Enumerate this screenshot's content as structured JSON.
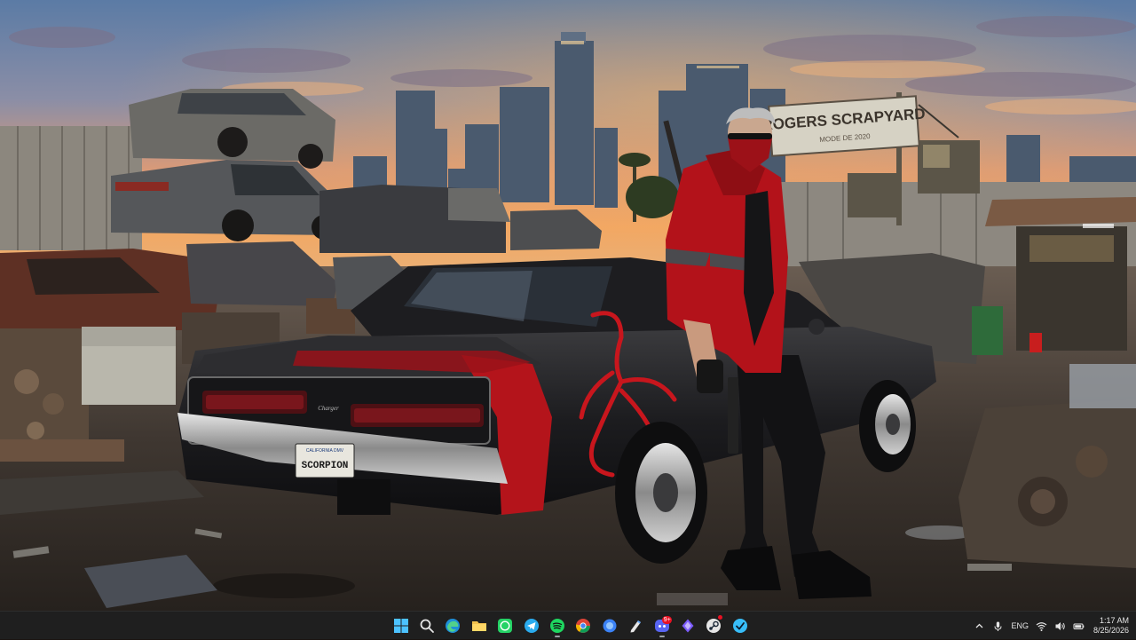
{
  "wallpaper": {
    "sign_text": "ROGERS SCRAPYARD",
    "sign_subtext": "MODE DE 2020",
    "plate_state": "CALIFORNIA DMV",
    "plate_text": "SCORPION",
    "car_badge": "Charger"
  },
  "taskbar": {
    "apps": [
      {
        "name": "start",
        "icon": "windows-logo"
      },
      {
        "name": "search",
        "icon": "search-icon"
      },
      {
        "name": "edge",
        "icon": "edge-icon"
      },
      {
        "name": "file-explorer",
        "icon": "folder-icon"
      },
      {
        "name": "whatsapp",
        "icon": "whatsapp-icon"
      },
      {
        "name": "telegram",
        "icon": "telegram-icon"
      },
      {
        "name": "spotify",
        "icon": "spotify-icon"
      },
      {
        "name": "chrome",
        "icon": "chrome-icon"
      },
      {
        "name": "blue-circle-app",
        "icon": "blue-circle-icon"
      },
      {
        "name": "pen-app",
        "icon": "pen-icon"
      },
      {
        "name": "discord",
        "icon": "discord-icon",
        "badge": "9+"
      },
      {
        "name": "diamond-app",
        "icon": "diamond-icon"
      },
      {
        "name": "steam",
        "icon": "steam-icon"
      },
      {
        "name": "check-app",
        "icon": "check-circle-icon"
      }
    ],
    "tray": {
      "language": "ENG",
      "time": "1:17 AM",
      "date": "8/25/2026"
    }
  },
  "colors": {
    "taskbar_bg": "#1f1f1f",
    "sky_top": "#5a7aa6",
    "sky_horizon": "#f0a060",
    "car_body": "#1e1e20",
    "stripe_red": "#c2161d",
    "jacket_red": "#b3121a"
  }
}
